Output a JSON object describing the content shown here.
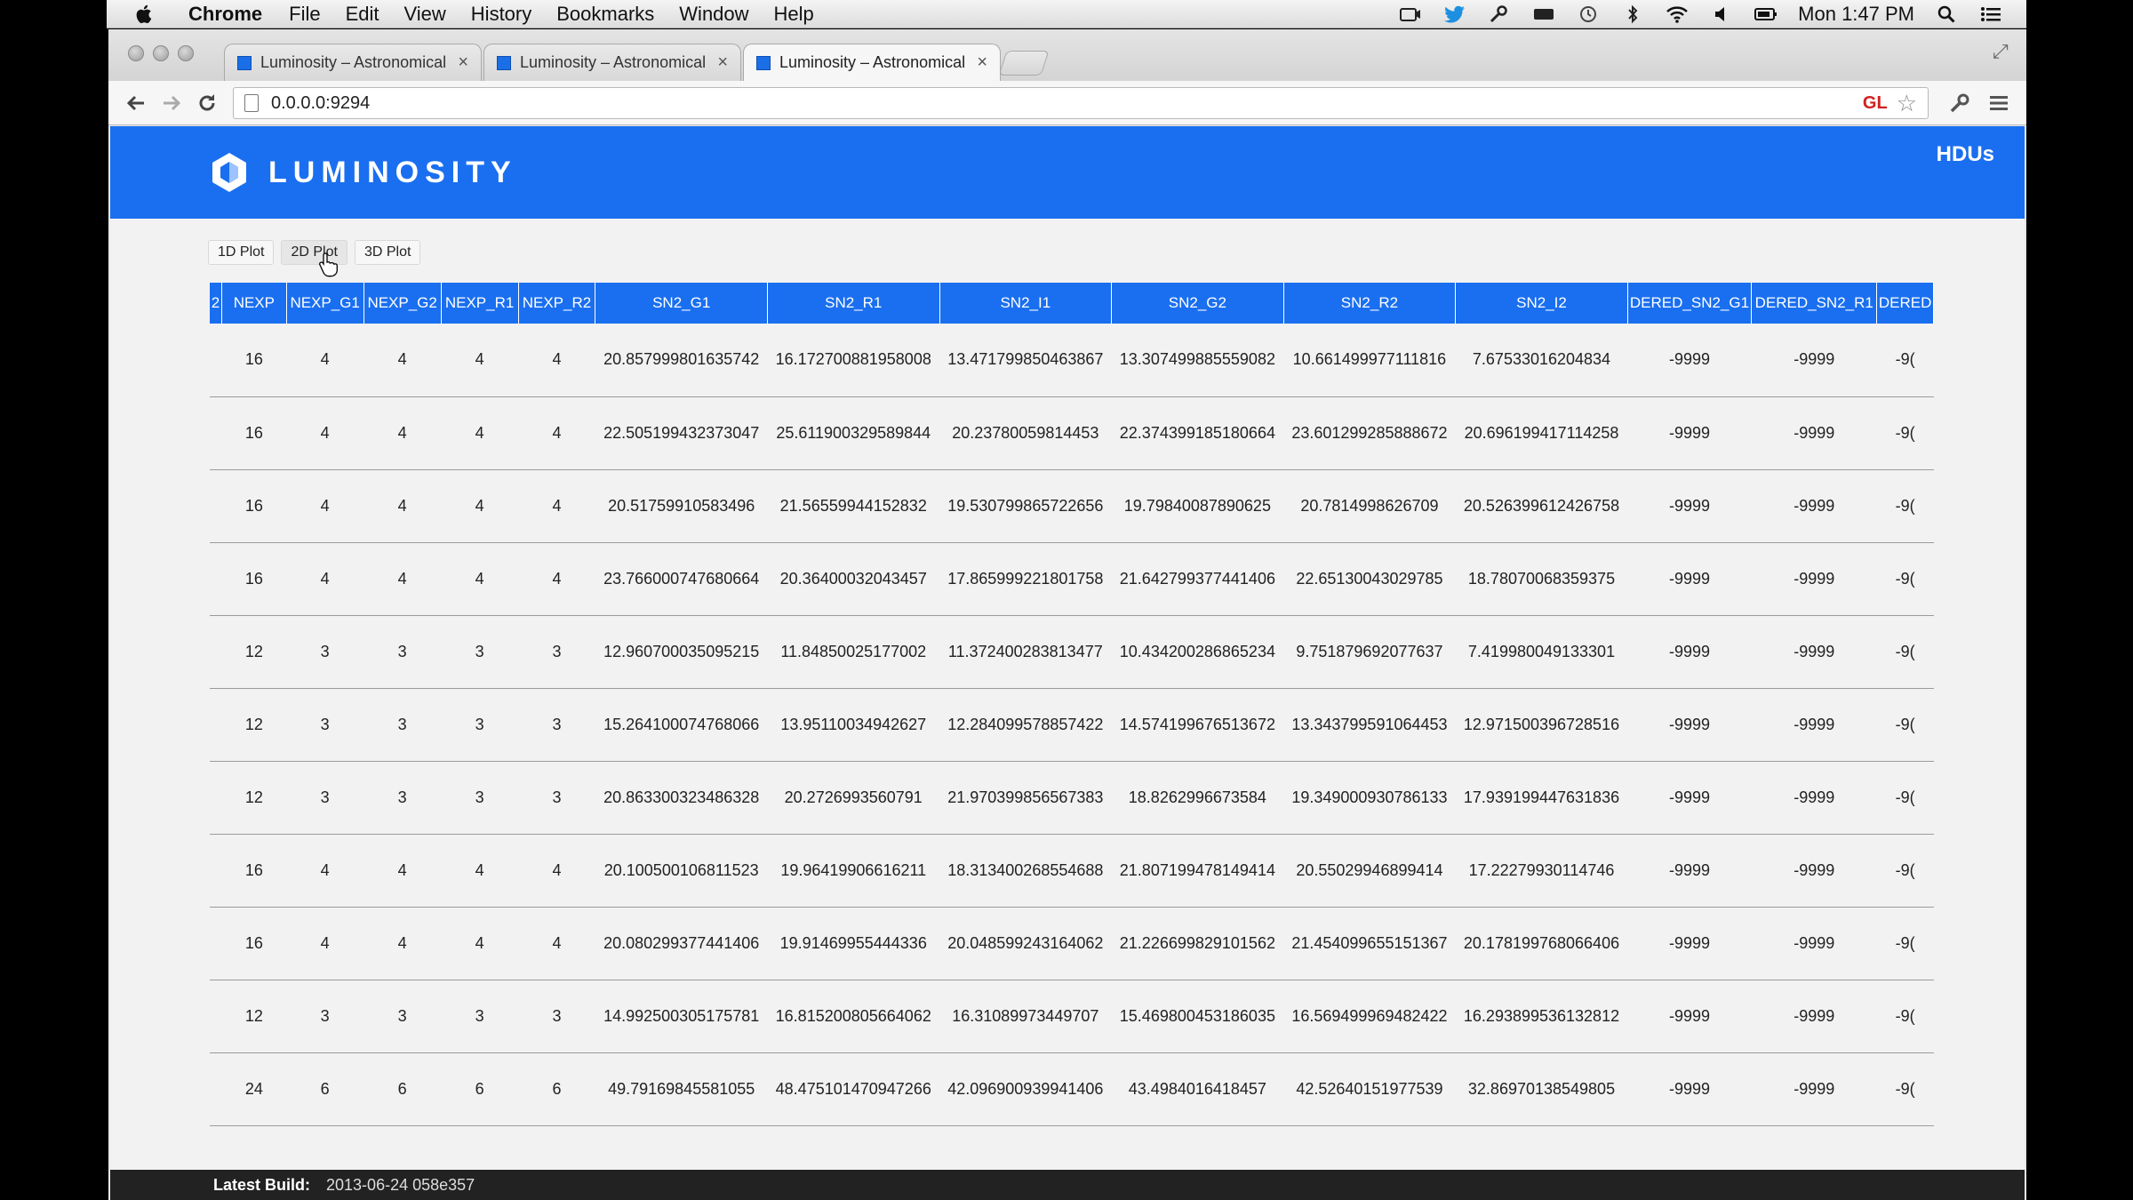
{
  "menubar": {
    "app": "Chrome",
    "items": [
      "File",
      "Edit",
      "View",
      "History",
      "Bookmarks",
      "Window",
      "Help"
    ],
    "clock": "Mon 1:47 PM"
  },
  "browser": {
    "tabs": [
      {
        "title": "Luminosity – Astronomical"
      },
      {
        "title": "Luminosity – Astronomical"
      },
      {
        "title": "Luminosity – Astronomical"
      }
    ],
    "close_glyph": "×",
    "url": "0.0.0.0:9294",
    "gl_badge": "GL",
    "star_glyph": "☆"
  },
  "page": {
    "brand": "LUMINOSITY",
    "nav_hdus": "HDUs",
    "plot_buttons": [
      "1D Plot",
      "2D Plot",
      "3D Plot"
    ],
    "table": {
      "columns": [
        "2",
        "NEXP",
        "NEXP_G1",
        "NEXP_G2",
        "NEXP_R1",
        "NEXP_R2",
        "SN2_G1",
        "SN2_R1",
        "SN2_I1",
        "SN2_G2",
        "SN2_R2",
        "SN2_I2",
        "DERED_SN2_G1",
        "DERED_SN2_R1",
        "DERED"
      ],
      "rows": [
        [
          "",
          "16",
          "4",
          "4",
          "4",
          "4",
          "20.857999801635742",
          "16.172700881958008",
          "13.471799850463867",
          "13.307499885559082",
          "10.661499977111816",
          "7.67533016204834",
          "-9999",
          "-9999",
          "-9("
        ],
        [
          "",
          "16",
          "4",
          "4",
          "4",
          "4",
          "22.505199432373047",
          "25.611900329589844",
          "20.23780059814453",
          "22.374399185180664",
          "23.601299285888672",
          "20.696199417114258",
          "-9999",
          "-9999",
          "-9("
        ],
        [
          "",
          "16",
          "4",
          "4",
          "4",
          "4",
          "20.51759910583496",
          "21.56559944152832",
          "19.530799865722656",
          "19.79840087890625",
          "20.7814998626709",
          "20.526399612426758",
          "-9999",
          "-9999",
          "-9("
        ],
        [
          "",
          "16",
          "4",
          "4",
          "4",
          "4",
          "23.766000747680664",
          "20.36400032043457",
          "17.865999221801758",
          "21.642799377441406",
          "22.65130043029785",
          "18.78070068359375",
          "-9999",
          "-9999",
          "-9("
        ],
        [
          "",
          "12",
          "3",
          "3",
          "3",
          "3",
          "12.960700035095215",
          "11.84850025177002",
          "11.372400283813477",
          "10.434200286865234",
          "9.751879692077637",
          "7.419980049133301",
          "-9999",
          "-9999",
          "-9("
        ],
        [
          "",
          "12",
          "3",
          "3",
          "3",
          "3",
          "15.264100074768066",
          "13.95110034942627",
          "12.284099578857422",
          "14.574199676513672",
          "13.343799591064453",
          "12.971500396728516",
          "-9999",
          "-9999",
          "-9("
        ],
        [
          "",
          "12",
          "3",
          "3",
          "3",
          "3",
          "20.863300323486328",
          "20.2726993560791",
          "21.970399856567383",
          "18.8262996673584",
          "19.349000930786133",
          "17.939199447631836",
          "-9999",
          "-9999",
          "-9("
        ],
        [
          "",
          "16",
          "4",
          "4",
          "4",
          "4",
          "20.100500106811523",
          "19.96419906616211",
          "18.313400268554688",
          "21.807199478149414",
          "20.55029946899414",
          "17.22279930114746",
          "-9999",
          "-9999",
          "-9("
        ],
        [
          "",
          "16",
          "4",
          "4",
          "4",
          "4",
          "20.080299377441406",
          "19.91469955444336",
          "20.048599243164062",
          "21.226699829101562",
          "21.454099655151367",
          "20.178199768066406",
          "-9999",
          "-9999",
          "-9("
        ],
        [
          "",
          "12",
          "3",
          "3",
          "3",
          "3",
          "14.992500305175781",
          "16.815200805664062",
          "16.31089973449707",
          "15.469800453186035",
          "16.569499969482422",
          "16.293899536132812",
          "-9999",
          "-9999",
          "-9("
        ],
        [
          "",
          "24",
          "6",
          "6",
          "6",
          "6",
          "49.79169845581055",
          "48.475101470947266",
          "42.096900939941406",
          "43.4984016418457",
          "42.52640151977539",
          "32.86970138549805",
          "-9999",
          "-9999",
          "-9("
        ]
      ]
    },
    "footer": {
      "label": "Latest Build:",
      "value": "2013-06-24 058e357"
    }
  },
  "colors": {
    "brand_blue": "#1a6ff0",
    "footer_bg": "#222222",
    "page_bg": "#f2f2f2"
  }
}
